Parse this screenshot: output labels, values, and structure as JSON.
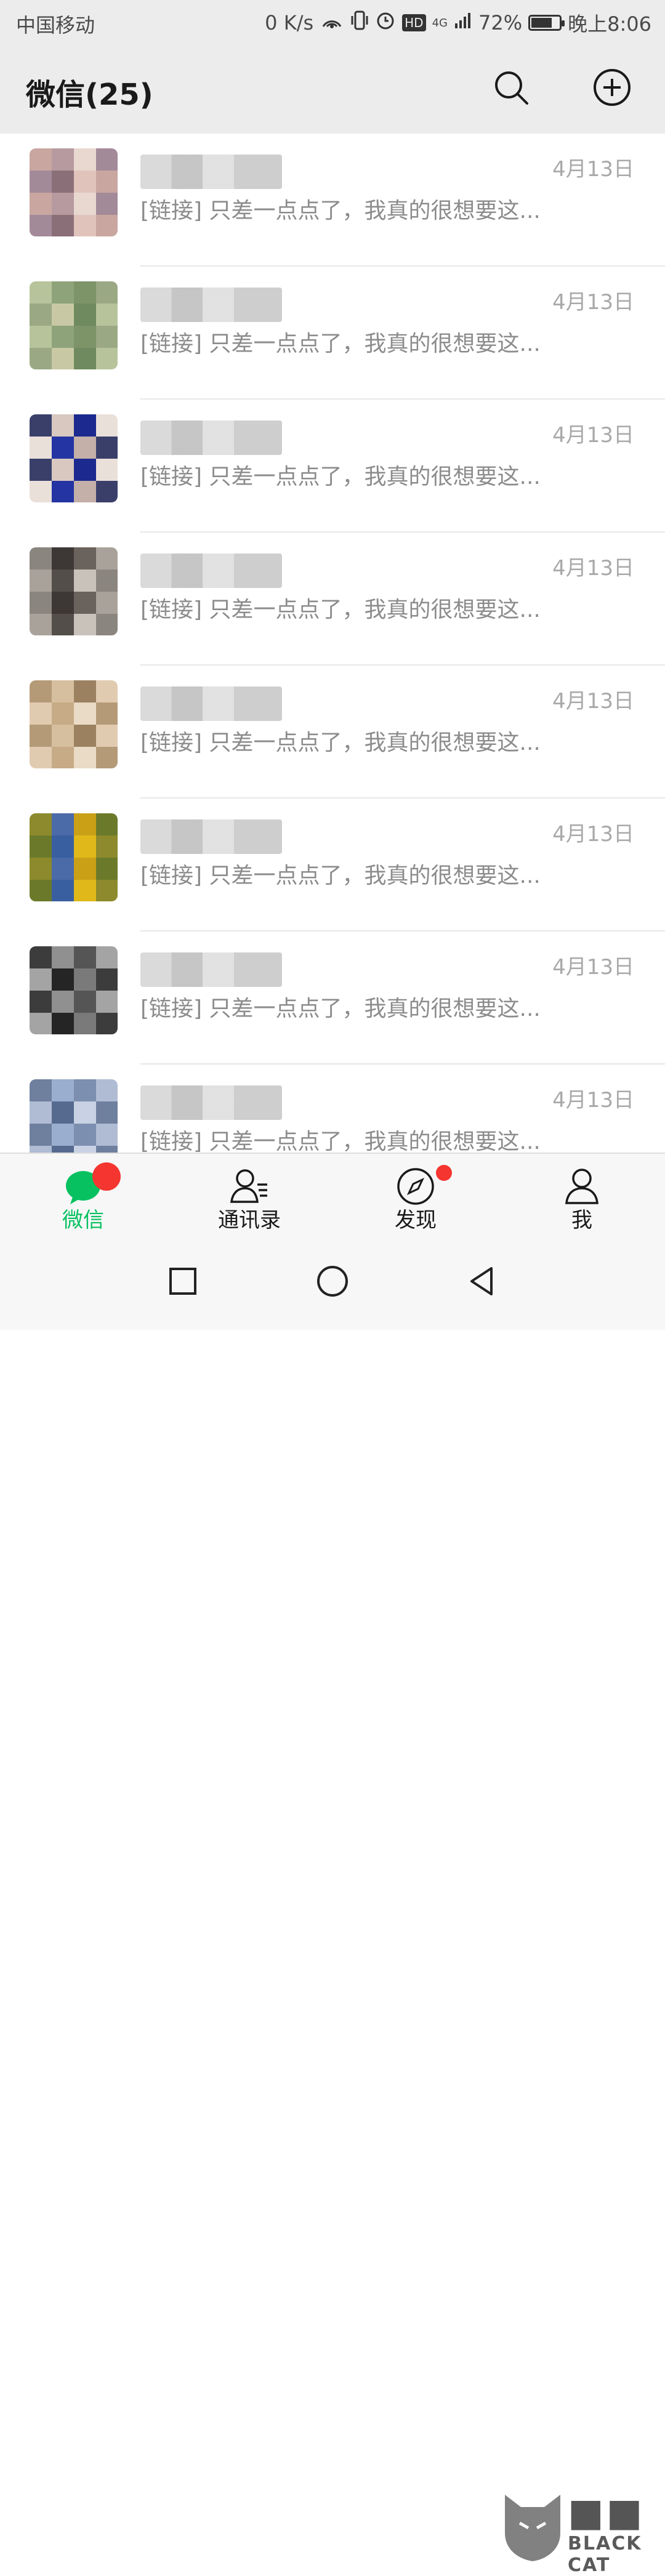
{
  "status_bar": {
    "carrier": "中国移动",
    "speed": "0 K/s",
    "hotspot": "1",
    "hd": "HD",
    "network": "4G",
    "battery": "72%",
    "battery_level": 0.72,
    "time": "晚上8:06"
  },
  "header": {
    "title": "微信(25)",
    "search_icon": "search-icon",
    "plus_icon": "add-circle-icon"
  },
  "chats": [
    {
      "time": "4月13日",
      "preview": "[链接] 只差一点点了，我真的很想要这..."
    },
    {
      "time": "4月13日",
      "preview": "[链接] 只差一点点了，我真的很想要这..."
    },
    {
      "time": "4月13日",
      "preview": "[链接] 只差一点点了，我真的很想要这..."
    },
    {
      "time": "4月13日",
      "preview": "[链接] 只差一点点了，我真的很想要这..."
    },
    {
      "time": "4月13日",
      "preview": "[链接] 只差一点点了，我真的很想要这..."
    },
    {
      "time": "4月13日",
      "preview": "[链接] 只差一点点了，我真的很想要这..."
    },
    {
      "time": "4月13日",
      "preview": "[链接] 只差一点点了，我真的很想要这..."
    },
    {
      "time": "4月13日",
      "preview": "[链接] 只差一点点了，我真的很想要这..."
    }
  ],
  "tabs": [
    {
      "label": "微信",
      "icon": "chat-bubble-icon"
    },
    {
      "label": "通讯录",
      "icon": "contacts-icon"
    },
    {
      "label": "发现",
      "icon": "compass-icon"
    },
    {
      "label": "我",
      "icon": "profile-icon"
    }
  ],
  "nav": {
    "recent": "square-icon",
    "home": "circle-icon",
    "back": "triangle-back-icon"
  },
  "watermark": {
    "brand": "BLACK CAT"
  },
  "colors": {
    "accent": "#07c160",
    "badge": "#f43530",
    "header_bg": "#ececec"
  }
}
